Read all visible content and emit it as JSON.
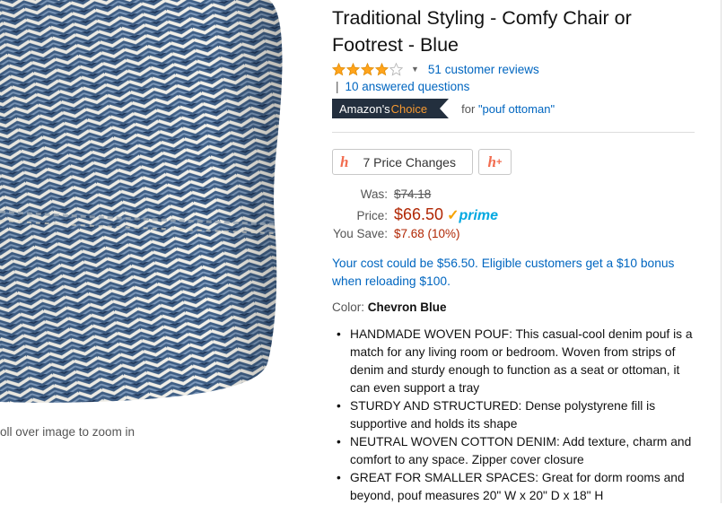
{
  "image": {
    "zoom_hint": "oll over image to zoom in"
  },
  "product": {
    "title": "Traditional Styling - Comfy Chair or Footrest - Blue",
    "rating": {
      "stars": 4,
      "max_stars": 5,
      "reviews_link": "51 customer reviews"
    },
    "qa": {
      "separator": "|",
      "link": "10 answered questions"
    },
    "choice": {
      "badge_prefix": "Amazon's",
      "badge_highlight": "Choice",
      "for_label": "for",
      "keyword": "\"pouf ottoman\""
    },
    "honey": {
      "price_changes_icon": "h",
      "price_changes_label": "7 Price Changes",
      "plus_icon": "h",
      "plus_sup": "+"
    },
    "price": {
      "was_label": "Was:",
      "was_value": "$74.18",
      "price_label": "Price:",
      "price_value": "$66.50",
      "prime_check": "✓",
      "prime_label": "prime",
      "save_label": "You Save:",
      "save_value": "$7.68 (10%)"
    },
    "cost_offer": "Your cost could be $56.50. Eligible customers get a $10 bonus when reloading $100.",
    "color": {
      "label": "Color:",
      "value": "Chevron Blue"
    },
    "bullets": [
      "HANDMADE WOVEN POUF: This casual-cool denim pouf is a match for any living room or bedroom. Woven from strips of denim and sturdy enough to function as a seat or ottoman, it can even support a tray",
      "STURDY AND STRUCTURED: Dense polystyrene fill is supportive and holds its shape",
      "NEUTRAL WOVEN COTTON DENIM: Add texture, charm and comfort to any space. Zipper cover closure",
      "GREAT FOR SMALLER SPACES: Great for dorm rooms and beyond, pouf measures 20\" W x 20\" D x 18\" H"
    ]
  },
  "colors": {
    "link": "#0066c0",
    "price": "#b12704",
    "star": "#ffa41c",
    "badge_bg": "#232f3e",
    "badge_accent": "#f69931",
    "honey": "#f26c4f",
    "prime": "#00a8e1"
  }
}
